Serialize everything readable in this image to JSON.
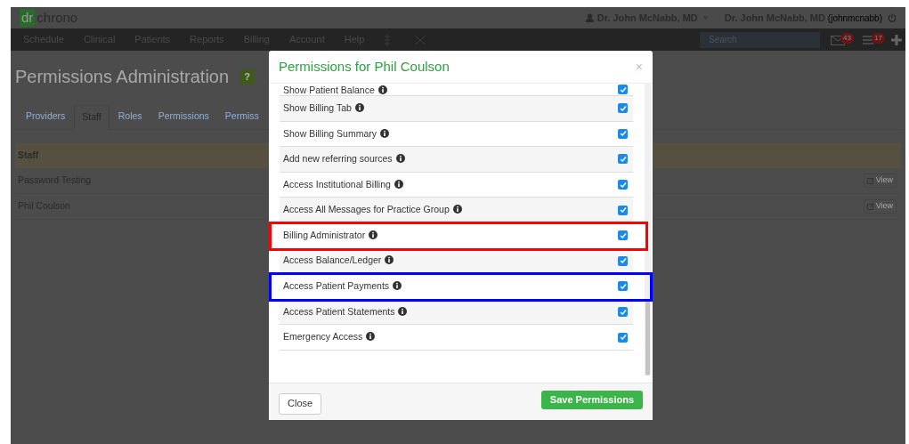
{
  "header": {
    "logo_mark": "dr",
    "logo_text": "chrono",
    "user_menu": "Dr. John McNabb, MD",
    "account_name": "Dr. John McNabb, MD",
    "account_handle": "(johnmcnabb)"
  },
  "nav": {
    "items": [
      "Schedule",
      "Clinical",
      "Patients",
      "Reports",
      "Billing",
      "Account",
      "Help"
    ],
    "search": {
      "placeholder": "Search"
    },
    "messages_badge": "43",
    "tasks_badge": "17"
  },
  "page": {
    "title": "Permissions Administration",
    "help_badge": "?",
    "tabs": [
      {
        "label": "Providers",
        "selected": false
      },
      {
        "label": "Staff",
        "selected": true
      },
      {
        "label": "Roles",
        "selected": false
      },
      {
        "label": "Permissions",
        "selected": false
      },
      {
        "label": "Permiss",
        "selected": false
      }
    ],
    "table": {
      "header": "Staff",
      "rows": [
        {
          "name": "Password Testing",
          "action": "View"
        },
        {
          "name": "Phil Coulson",
          "action": "View"
        }
      ]
    }
  },
  "dialog": {
    "title": "Permissions for Phil Coulson",
    "close": "×",
    "permissions": [
      {
        "label": "Show Patient Balance",
        "checked": true
      },
      {
        "label": "Show Billing Tab",
        "checked": true
      },
      {
        "label": "Show Billing Summary",
        "checked": true
      },
      {
        "label": "Add new referring sources",
        "checked": true
      },
      {
        "label": "Access Institutional Billing",
        "checked": true
      },
      {
        "label": "Access All Messages for Practice Group",
        "checked": true
      },
      {
        "label": "Billing Administrator",
        "checked": true,
        "color": "#ff0000"
      },
      {
        "label": "Access Balance/Ledger",
        "checked": true
      },
      {
        "label": "Access Patient Payments",
        "checked": true,
        "color": "#0000ff"
      },
      {
        "label": "Access Patient Statements",
        "checked": true
      },
      {
        "label": "Emergency Access",
        "checked": true
      }
    ],
    "buttons": {
      "close": "Close",
      "save": "Save Permissions"
    }
  }
}
